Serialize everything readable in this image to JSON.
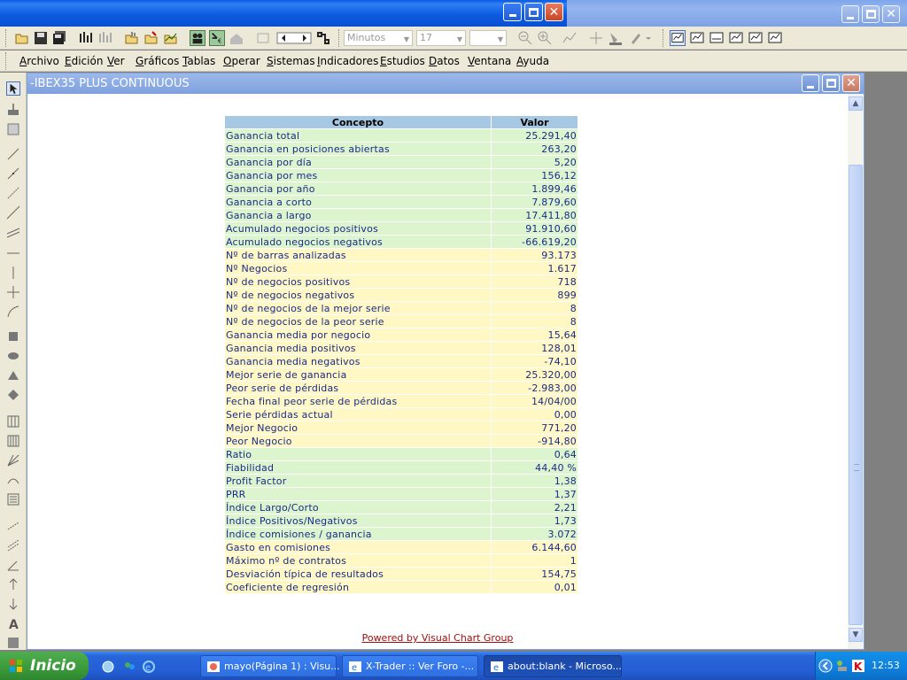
{
  "app": {
    "inner_window_title": "-IBEX35 PLUS CONTINUOUS"
  },
  "toolbar": {
    "timeframe_select": "Minutos",
    "period_select": "17",
    "blank_select": ""
  },
  "menu": [
    {
      "label": "Archivo"
    },
    {
      "label": "Edición"
    },
    {
      "label": "Ver"
    },
    {
      "label": "Gráficos"
    },
    {
      "label": "Tablas"
    },
    {
      "label": "Operar"
    },
    {
      "label": "Sistemas"
    },
    {
      "label": "Indicadores"
    },
    {
      "label": "Estudios"
    },
    {
      "label": "Datos"
    },
    {
      "label": "Ventana"
    },
    {
      "label": "Ayuda"
    }
  ],
  "stats_table": {
    "headers": [
      "Concepto",
      "Valor"
    ],
    "rows": [
      {
        "concept": "Ganancia total",
        "value": "25.291,40",
        "group": "g"
      },
      {
        "concept": "Ganancia en posiciones abiertas",
        "value": "263,20",
        "group": "g"
      },
      {
        "concept": "Ganancia por día",
        "value": "5,20",
        "group": "g"
      },
      {
        "concept": "Ganancia por mes",
        "value": "156,12",
        "group": "g"
      },
      {
        "concept": "Ganancia por año",
        "value": "1.899,46",
        "group": "g"
      },
      {
        "concept": "Ganancia a corto",
        "value": "7.879,60",
        "group": "g"
      },
      {
        "concept": "Ganancia a largo",
        "value": "17.411,80",
        "group": "g"
      },
      {
        "concept": "Acumulado negocios positivos",
        "value": "91.910,60",
        "group": "g"
      },
      {
        "concept": "Acumulado negocios negativos",
        "value": "-66.619,20",
        "group": "g"
      },
      {
        "concept": "Nº de barras analizadas",
        "value": "93.173",
        "group": "y"
      },
      {
        "concept": "Nº Negocios",
        "value": "1.617",
        "group": "y"
      },
      {
        "concept": "Nº de negocios positivos",
        "value": "718",
        "group": "y"
      },
      {
        "concept": "Nº de negocios negativos",
        "value": "899",
        "group": "y"
      },
      {
        "concept": "Nº de negocios de la mejor serie",
        "value": "8",
        "group": "y"
      },
      {
        "concept": "Nº de negocios de la peor serie",
        "value": "8",
        "group": "y"
      },
      {
        "concept": "Ganancia media por negocio",
        "value": "15,64",
        "group": "y"
      },
      {
        "concept": "Ganancia media positivos",
        "value": "128,01",
        "group": "y"
      },
      {
        "concept": "Ganancia media negativos",
        "value": "-74,10",
        "group": "y"
      },
      {
        "concept": "Mejor serie de ganancia",
        "value": "25.320,00",
        "group": "y"
      },
      {
        "concept": "Peor serie de pérdidas",
        "value": "-2.983,00",
        "group": "y"
      },
      {
        "concept": "Fecha final peor serie de pérdidas",
        "value": "14/04/00",
        "group": "y"
      },
      {
        "concept": "Serie pérdidas actual",
        "value": "0,00",
        "group": "y"
      },
      {
        "concept": "Mejor Negocio",
        "value": "771,20",
        "group": "y"
      },
      {
        "concept": "Peor Negocio",
        "value": "-914,80",
        "group": "y"
      },
      {
        "concept": "Ratio",
        "value": "0,64",
        "group": "g"
      },
      {
        "concept": "Fiabilidad",
        "value": "44,40 %",
        "group": "g"
      },
      {
        "concept": "Profit Factor",
        "value": "1,38",
        "group": "g"
      },
      {
        "concept": "PRR",
        "value": "1,37",
        "group": "g"
      },
      {
        "concept": "Índice Largo/Corto",
        "value": "2,21",
        "group": "g"
      },
      {
        "concept": "Índice Positivos/Negativos",
        "value": "1,73",
        "group": "g"
      },
      {
        "concept": "Índice comisiones / ganancia",
        "value": "3.072",
        "group": "g"
      },
      {
        "concept": "Gasto en comisiones",
        "value": "6.144,60",
        "group": "y"
      },
      {
        "concept": "Máximo nº de contratos",
        "value": "1",
        "group": "y"
      },
      {
        "concept": "Desviación típica de resultados",
        "value": "154,75",
        "group": "y"
      },
      {
        "concept": "Coeficiente de regresión",
        "value": "0,01",
        "group": "y"
      }
    ]
  },
  "footer": {
    "powered_by": "Powered by Visual Chart Group"
  },
  "taskbar": {
    "start_label": "Inicio",
    "tasks": [
      {
        "label": "mayo(Página 1) : Visu..."
      },
      {
        "label": "X-Trader :: Ver Foro -..."
      },
      {
        "label": "about:blank - Microso..."
      }
    ],
    "clock": "12:53"
  },
  "colors": {
    "group_green": "#dcf5cf",
    "group_yellow": "#fff8c4",
    "header_blue": "#a6c8e2",
    "text_navy": "#1a2a8a",
    "link_red": "#a01010"
  }
}
